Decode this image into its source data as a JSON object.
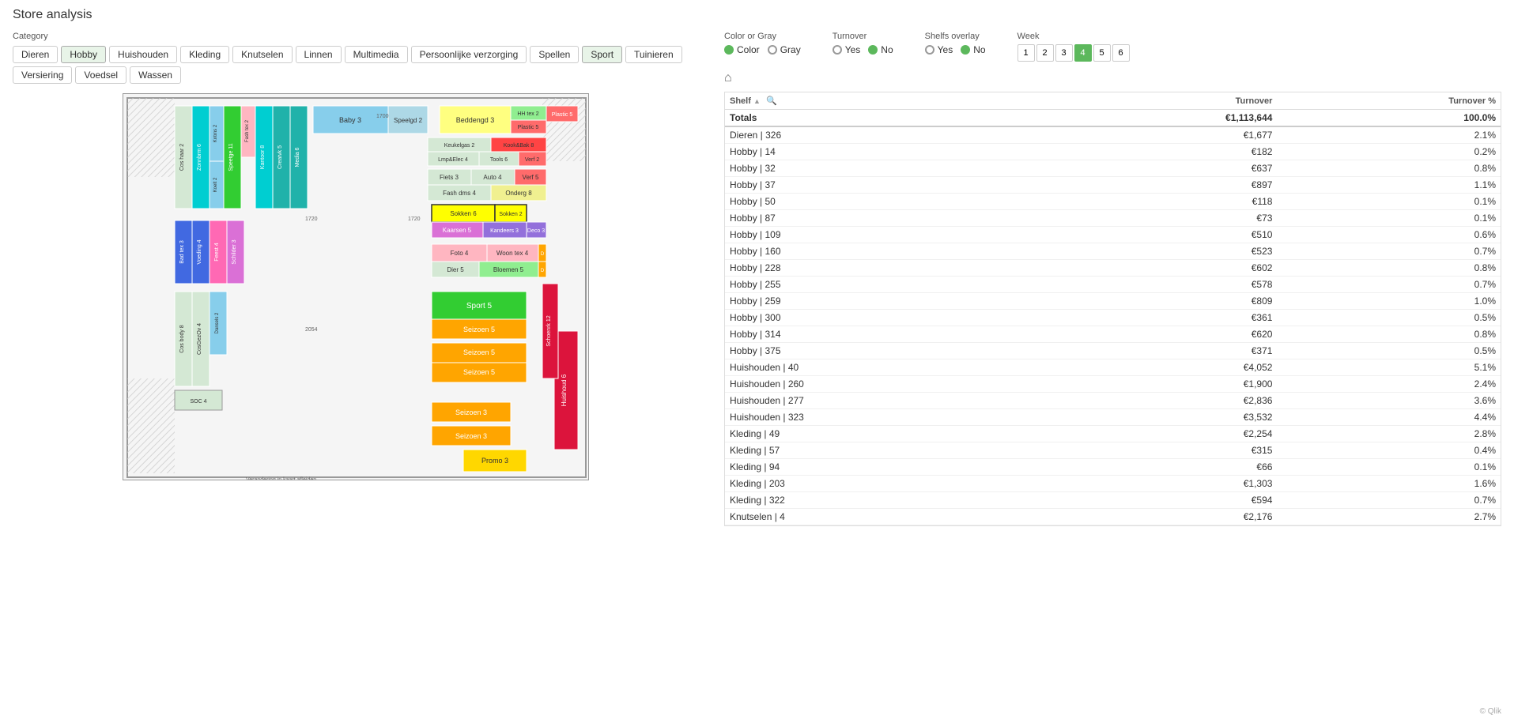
{
  "title": "Store analysis",
  "category": {
    "label": "Category",
    "buttons": [
      {
        "id": "dieren",
        "label": "Dieren",
        "active": false
      },
      {
        "id": "hobby",
        "label": "Hobby",
        "active": true
      },
      {
        "id": "huishouden",
        "label": "Huishouden",
        "active": false
      },
      {
        "id": "kleding",
        "label": "Kleding",
        "active": false
      },
      {
        "id": "knutselen",
        "label": "Knutselen",
        "active": false
      },
      {
        "id": "linnen",
        "label": "Linnen",
        "active": false
      },
      {
        "id": "multimedia",
        "label": "Multimedia",
        "active": false
      },
      {
        "id": "persoonlijke",
        "label": "Persoonlijke verzorging",
        "active": false
      },
      {
        "id": "spellen",
        "label": "Spellen",
        "active": false
      },
      {
        "id": "sport",
        "label": "Sport",
        "active": true
      },
      {
        "id": "tuinieren",
        "label": "Tuinieren",
        "active": false
      },
      {
        "id": "versiering",
        "label": "Versiering",
        "active": false
      },
      {
        "id": "voedsel",
        "label": "Voedsel",
        "active": false
      },
      {
        "id": "wassen",
        "label": "Wassen",
        "active": false
      }
    ]
  },
  "colorOrGray": {
    "label": "Color or Gray",
    "options": [
      {
        "label": "Color",
        "selected": true
      },
      {
        "label": "Gray",
        "selected": false
      }
    ]
  },
  "turnover": {
    "label": "Turnover",
    "options": [
      {
        "label": "Yes",
        "selected": false
      },
      {
        "label": "No",
        "selected": true
      }
    ]
  },
  "shelfsOverlay": {
    "label": "Shelfs overlay",
    "options": [
      {
        "label": "Yes",
        "selected": false
      },
      {
        "label": "No",
        "selected": true
      }
    ]
  },
  "week": {
    "label": "Week",
    "buttons": [
      "1",
      "2",
      "3",
      "4",
      "5",
      "6"
    ],
    "active": "4"
  },
  "table": {
    "columns": [
      "Shelf",
      "Turnover",
      "Turnover %"
    ],
    "totals": {
      "label": "Totals",
      "turnover": "€1,113,644",
      "pct": "100.0%"
    },
    "rows": [
      {
        "shelf": "Dieren | 326",
        "turnover": "€1,677",
        "pct": "2.1%"
      },
      {
        "shelf": "Hobby | 14",
        "turnover": "€182",
        "pct": "0.2%"
      },
      {
        "shelf": "Hobby | 32",
        "turnover": "€637",
        "pct": "0.8%"
      },
      {
        "shelf": "Hobby | 37",
        "turnover": "€897",
        "pct": "1.1%"
      },
      {
        "shelf": "Hobby | 50",
        "turnover": "€118",
        "pct": "0.1%"
      },
      {
        "shelf": "Hobby | 87",
        "turnover": "€73",
        "pct": "0.1%"
      },
      {
        "shelf": "Hobby | 109",
        "turnover": "€510",
        "pct": "0.6%"
      },
      {
        "shelf": "Hobby | 160",
        "turnover": "€523",
        "pct": "0.7%"
      },
      {
        "shelf": "Hobby | 228",
        "turnover": "€602",
        "pct": "0.8%"
      },
      {
        "shelf": "Hobby | 255",
        "turnover": "€578",
        "pct": "0.7%"
      },
      {
        "shelf": "Hobby | 259",
        "turnover": "€809",
        "pct": "1.0%"
      },
      {
        "shelf": "Hobby | 300",
        "turnover": "€361",
        "pct": "0.5%"
      },
      {
        "shelf": "Hobby | 314",
        "turnover": "€620",
        "pct": "0.8%"
      },
      {
        "shelf": "Hobby | 375",
        "turnover": "€371",
        "pct": "0.5%"
      },
      {
        "shelf": "Huishouden | 40",
        "turnover": "€4,052",
        "pct": "5.1%"
      },
      {
        "shelf": "Huishouden | 260",
        "turnover": "€1,900",
        "pct": "2.4%"
      },
      {
        "shelf": "Huishouden | 277",
        "turnover": "€2,836",
        "pct": "3.6%"
      },
      {
        "shelf": "Huishouden | 323",
        "turnover": "€3,532",
        "pct": "4.4%"
      },
      {
        "shelf": "Kleding | 49",
        "turnover": "€2,254",
        "pct": "2.8%"
      },
      {
        "shelf": "Kleding | 57",
        "turnover": "€315",
        "pct": "0.4%"
      },
      {
        "shelf": "Kleding | 94",
        "turnover": "€66",
        "pct": "0.1%"
      },
      {
        "shelf": "Kleding | 203",
        "turnover": "€1,303",
        "pct": "1.6%"
      },
      {
        "shelf": "Kleding | 322",
        "turnover": "€594",
        "pct": "0.7%"
      },
      {
        "shelf": "Knutselen | 4",
        "turnover": "€2,176",
        "pct": "2.7%"
      }
    ]
  },
  "footer": "© Qlik"
}
